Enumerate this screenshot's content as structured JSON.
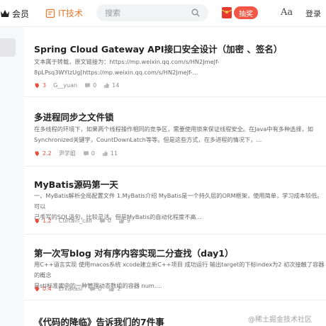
{
  "header": {
    "vip_label": "会员",
    "tech_label": "IT技术",
    "search_placeholder": "搜索",
    "lottery_label": "抽奖",
    "font_toggle": "Aa",
    "login_label": "登录"
  },
  "articles": [
    {
      "title": "Spring Cloud Gateway API接口安全设计（加密 、签名）",
      "summary": "文本属于转载，原文链接为：https://mp.weixin.qq.com/s/HN2JmeJf-\n8pLPsq3WYlzUg[https://mp.weixin.qq.com/s/HN2JmeJf-...",
      "hot": "3",
      "author": "G__yuan",
      "comments": "0",
      "likes": "14"
    },
    {
      "title": "多进程同步之文件锁",
      "summary": "在多线程的环境下，如果两个线程操作相同的竞争区，需要使用锁来保证线程安全。在Java中有多种选择，如\nSynchronized关键字，CountDownLatch等等。但是这些方式，在多进程的情况下，...",
      "hot": "2.2",
      "author": "尹学姐",
      "comments": "0",
      "likes": "11"
    },
    {
      "title": "MyBatis源码第一天",
      "summary": "一、MyBatis解析全局配置文件 1.MyBatis介绍 MyBatis是一个持久层的ORM框架，使用简单，学习成本较低。可以\n己手写的SQL语句，比较灵活。但是MyBatis的自动化程度不高...",
      "hot": "1.2",
      "author": "Curtain_call",
      "comments": "0",
      "likes": "9"
    },
    {
      "title": "第一次写blog 对有序内容实现二分查找（day1）",
      "summary": "用C++语言实现 使用macos系统 xcode建立新C++项目 成功运行 输出target的下标index为2 初次接触了容器的概念\n是stl标准库中的一种管理动态数组的容器 num....",
      "hot": "0.4",
      "author": "Erkakasi",
      "comments": "0",
      "likes": "2"
    },
    {
      "title": "《代码的降临》告诉我们的7件事"
    }
  ],
  "watermark": "@稀土掘金技术社区",
  "colors": {
    "accent": "#e87b2c",
    "hot": "#e74c3c",
    "lottery": "#f25745"
  }
}
